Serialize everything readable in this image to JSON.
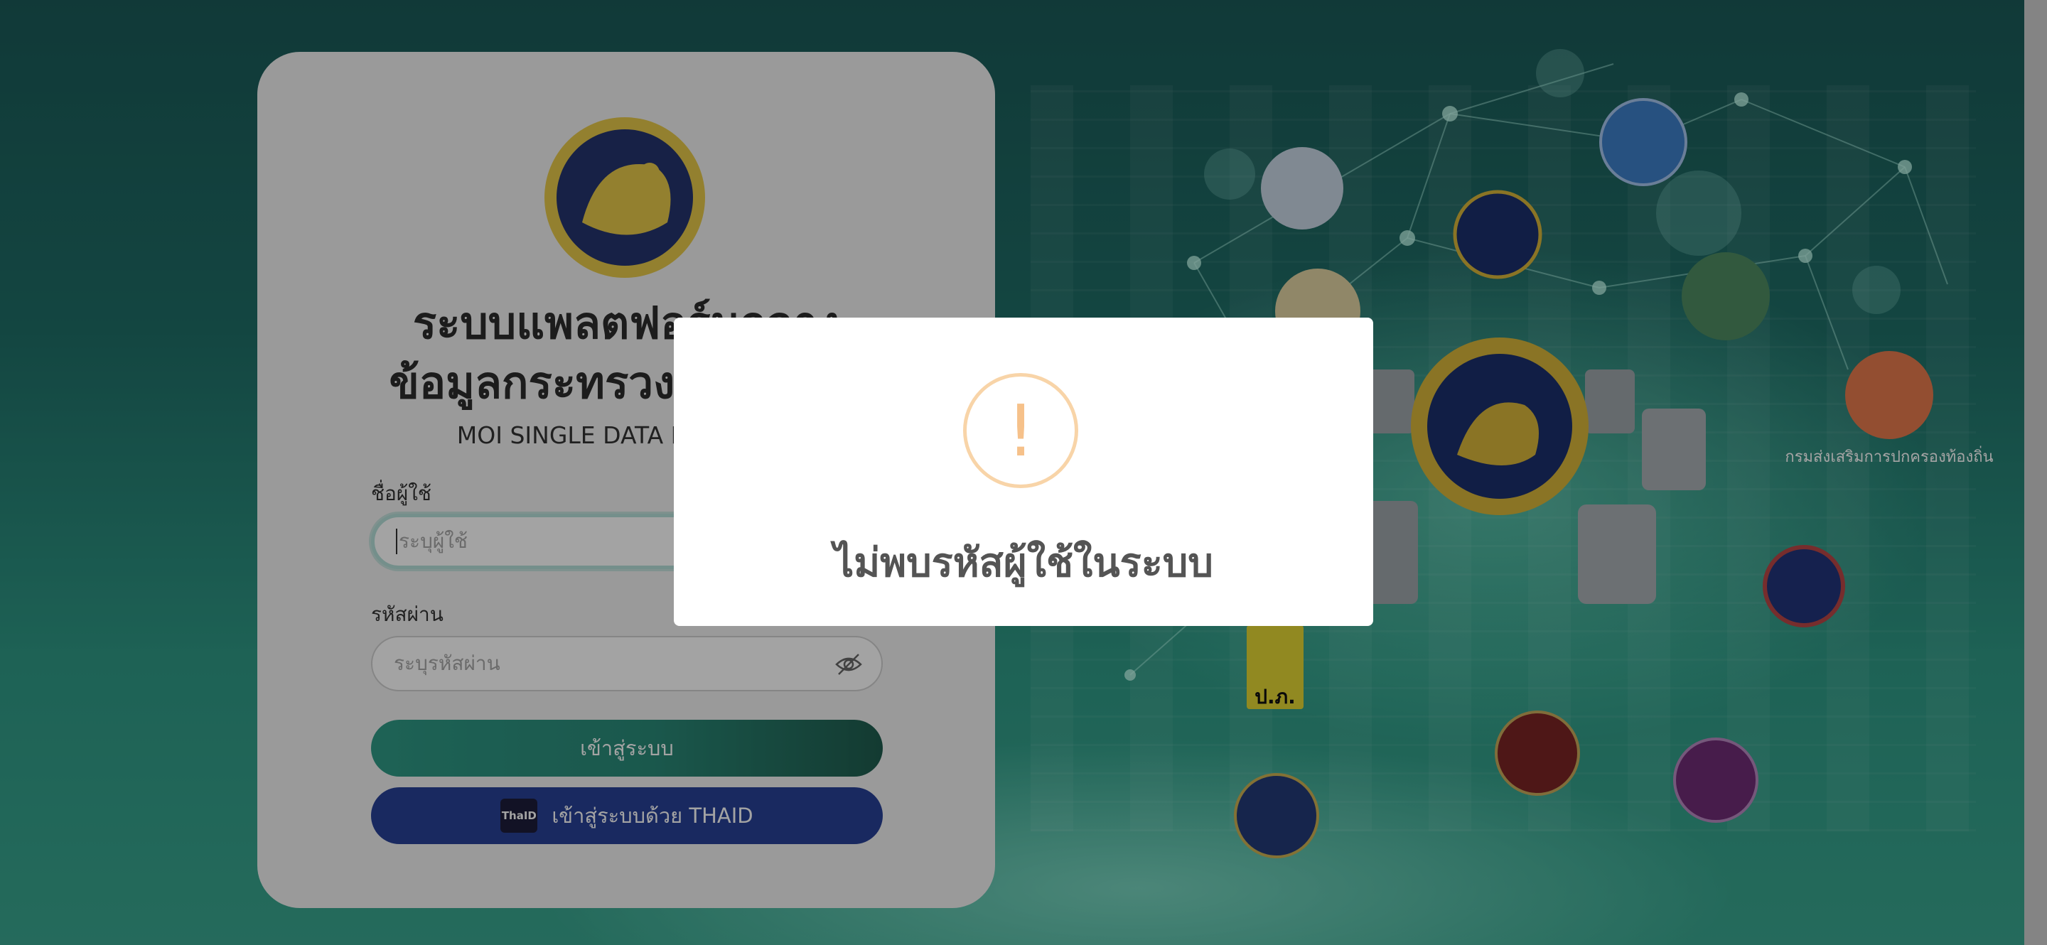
{
  "login": {
    "title_line1": "ระบบแพลตฟอร์มกลาง",
    "title_line2": "ข้อมูลกระทรวงมหาดไทย",
    "subtitle": "MOI SINGLE DATA PLATFORM",
    "username_label": "ชื่อผู้ใช้",
    "username_placeholder": "ระบุผู้ใช้",
    "password_label": "รหัสผ่าน",
    "password_placeholder": "ระบุรหัสผ่าน",
    "login_button": "เข้าสู่ระบบ",
    "thaid_button": "เข้าสู่ระบบด้วย THAID",
    "thaid_badge": "ThaID"
  },
  "background": {
    "emblem_caption": "กรมส่งเสริมการปกครองท้องถิ่น",
    "dopa_text": "ป.ภ."
  },
  "modal": {
    "icon_glyph": "!",
    "message": "ไม่พบรหัสผู้ใช้ในระบบ"
  },
  "colors": {
    "primary_green": "#2f9a86",
    "thaid_blue": "#284096",
    "alert_orange": "#f8bb86"
  }
}
